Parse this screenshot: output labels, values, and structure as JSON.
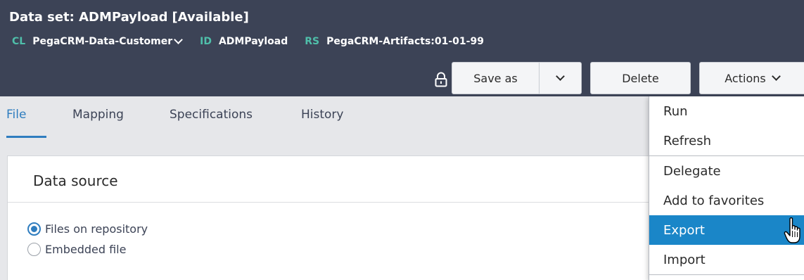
{
  "header": {
    "title": "Data set: ADMPayload",
    "availability": "[Available]",
    "meta": {
      "class_tag": "CL",
      "class_value": "PegaCRM-Data-Customer",
      "id_tag": "ID",
      "id_value": "ADMPayload",
      "ruleset_tag": "RS",
      "ruleset_value": "PegaCRM-Artifacts:01-01-99"
    }
  },
  "toolbar": {
    "save_as_label": "Save as",
    "delete_label": "Delete",
    "actions_label": "Actions"
  },
  "tabs": [
    {
      "label": "File",
      "active": true
    },
    {
      "label": "Mapping",
      "active": false
    },
    {
      "label": "Specifications",
      "active": false
    },
    {
      "label": "History",
      "active": false
    }
  ],
  "panel": {
    "title": "Data source",
    "options": [
      {
        "label": "Files on repository",
        "checked": true
      },
      {
        "label": "Embedded file",
        "checked": false
      }
    ]
  },
  "actions_menu": {
    "items": [
      {
        "label": "Run"
      },
      {
        "label": "Refresh"
      },
      {
        "label": "Delegate"
      },
      {
        "label": "Add to favorites"
      },
      {
        "label": "Export",
        "highlighted": true
      },
      {
        "label": "Import"
      }
    ]
  },
  "colors": {
    "header_bg": "#3c4356",
    "tag_teal": "#4fbfaa",
    "accent_blue": "#2f7dbf",
    "menu_highlight": "#1a86c8"
  }
}
